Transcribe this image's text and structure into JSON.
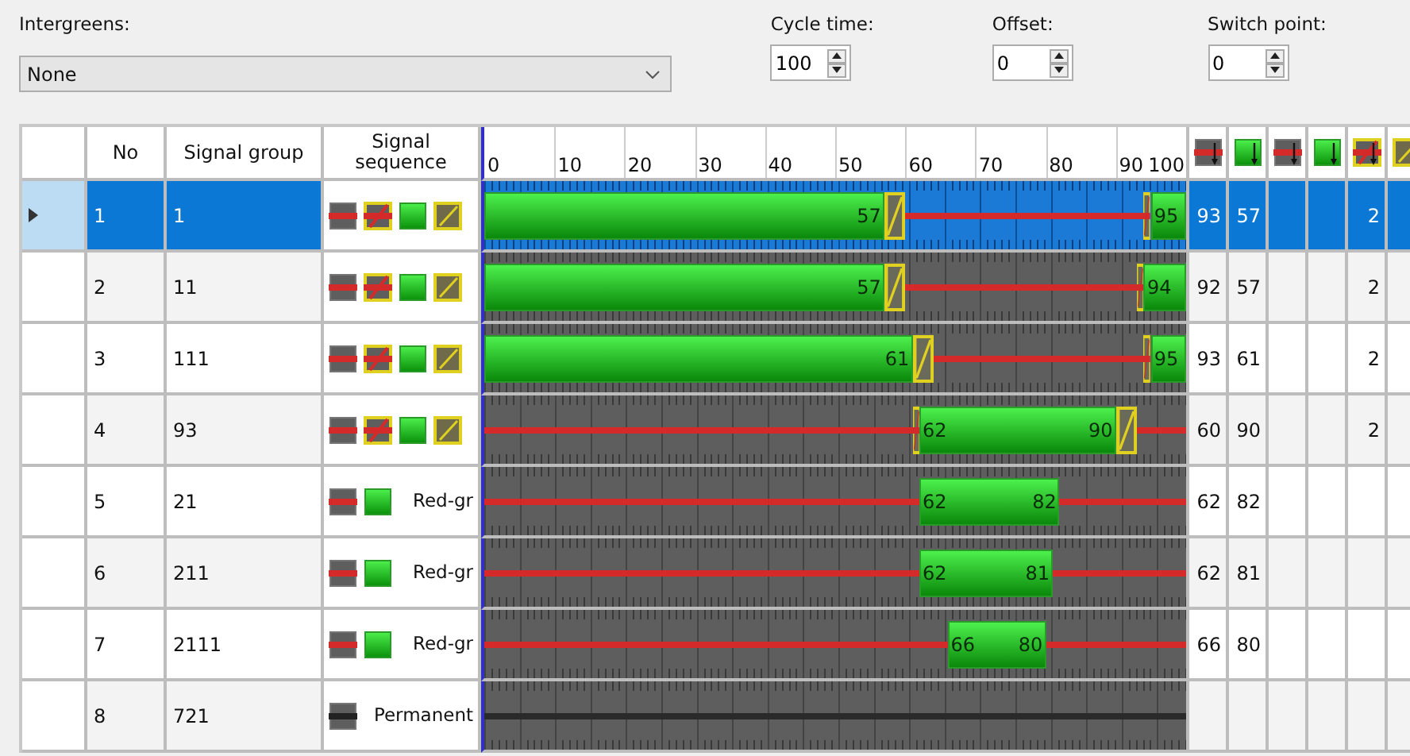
{
  "intergreens": {
    "label": "Intergreens:",
    "value": "None"
  },
  "cycle_time": {
    "label": "Cycle time:",
    "value": "100"
  },
  "offset": {
    "label": "Offset:",
    "value": "0"
  },
  "switch_point": {
    "label": "Switch point:",
    "value": "0"
  },
  "table": {
    "columns": {
      "no": "No",
      "signal_group": "Signal group",
      "signal_sequence": "Signal sequence"
    },
    "timeline_ticks": [
      "0",
      "10",
      "20",
      "30",
      "40",
      "50",
      "60",
      "70",
      "80",
      "90",
      "100"
    ],
    "value_columns": [
      {
        "kind": "red"
      },
      {
        "kind": "green"
      },
      {
        "kind": "red"
      },
      {
        "kind": "green"
      },
      {
        "kind": "red-amber"
      },
      {
        "kind": "amber"
      }
    ],
    "rows": [
      {
        "no": "1",
        "signal_group": "1",
        "selected": true,
        "kind": "full",
        "green_start": "95",
        "green_end": "57",
        "values": {
          "column_1": "93",
          "column_2": "57",
          "column_5": "2"
        }
      },
      {
        "no": "2",
        "signal_group": "11",
        "selected": false,
        "kind": "full",
        "green_start": "94",
        "green_end": "57",
        "values": {
          "column_1": "92",
          "column_2": "57",
          "column_5": "2"
        }
      },
      {
        "no": "3",
        "signal_group": "111",
        "selected": false,
        "kind": "full",
        "green_start": "95",
        "green_end": "61",
        "values": {
          "column_1": "93",
          "column_2": "61",
          "column_5": "2"
        }
      },
      {
        "no": "4",
        "signal_group": "93",
        "selected": false,
        "kind": "full",
        "green_start": "62",
        "green_end": "90",
        "values": {
          "column_1": "60",
          "column_2": "90",
          "column_5": "2"
        }
      },
      {
        "no": "5",
        "signal_group": "21",
        "selected": false,
        "kind": "red-green",
        "sequence_label": "Red-gr",
        "green_start": "62",
        "green_end": "82",
        "values": {
          "column_1": "62",
          "column_2": "82"
        }
      },
      {
        "no": "6",
        "signal_group": "211",
        "selected": false,
        "kind": "red-green",
        "sequence_label": "Red-gr",
        "green_start": "62",
        "green_end": "81",
        "values": {
          "column_1": "62",
          "column_2": "81"
        }
      },
      {
        "no": "7",
        "signal_group": "2111",
        "selected": false,
        "kind": "red-green",
        "sequence_label": "Red-gr",
        "green_start": "66",
        "green_end": "80",
        "values": {
          "column_1": "66",
          "column_2": "80"
        }
      },
      {
        "no": "8",
        "signal_group": "721",
        "selected": false,
        "kind": "permanent",
        "sequence_label": "Permanent"
      }
    ]
  }
}
